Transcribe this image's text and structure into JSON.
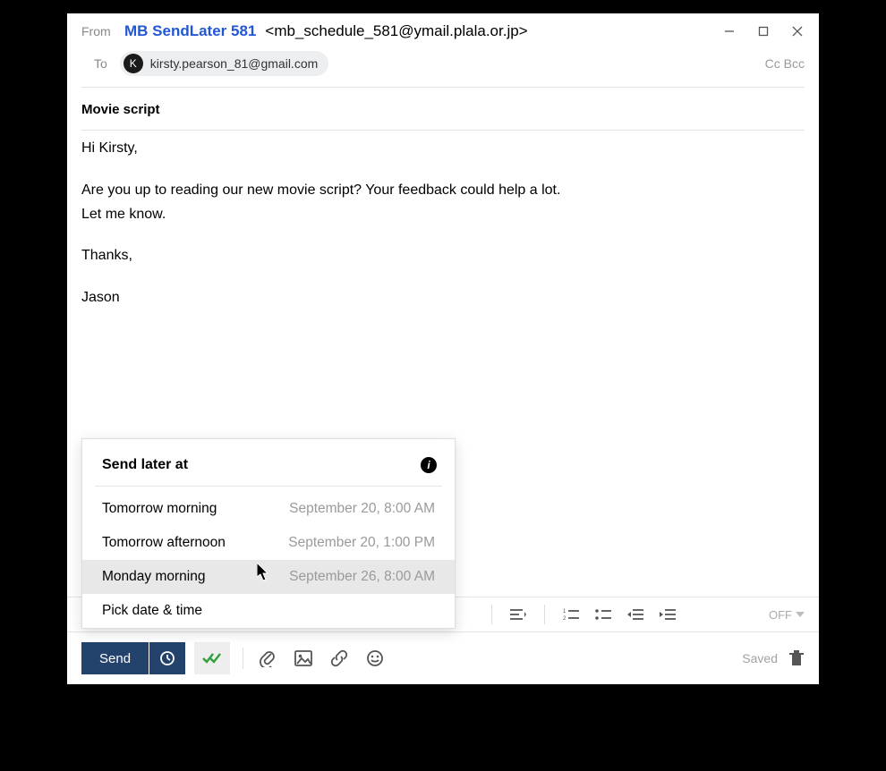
{
  "labels": {
    "from": "From",
    "to": "To",
    "ccbcc": "Cc Bcc"
  },
  "from": {
    "name": "MB SendLater 581",
    "email": "<mb_schedule_581@ymail.plala.or.jp>"
  },
  "to": {
    "initial": "K",
    "email": "kirsty.pearson_81@gmail.com"
  },
  "subject": "Movie script",
  "body": {
    "greeting": "Hi Kirsty,",
    "line1": "Are you up to reading our new movie script? Your feedback could help a lot.",
    "line2": "Let me know.",
    "thanks": "Thanks,",
    "sign": "Jason"
  },
  "popup": {
    "title": "Send later at",
    "rows": [
      {
        "label": "Tomorrow morning",
        "time": "September 20, 8:00 AM"
      },
      {
        "label": "Tomorrow afternoon",
        "time": "September 20, 1:00 PM"
      },
      {
        "label": "Monday morning",
        "time": "September 26, 8:00 AM"
      },
      {
        "label": "Pick date & time",
        "time": ""
      }
    ]
  },
  "toolbar": {
    "off": "OFF"
  },
  "bottom": {
    "send": "Send",
    "saved": "Saved"
  }
}
